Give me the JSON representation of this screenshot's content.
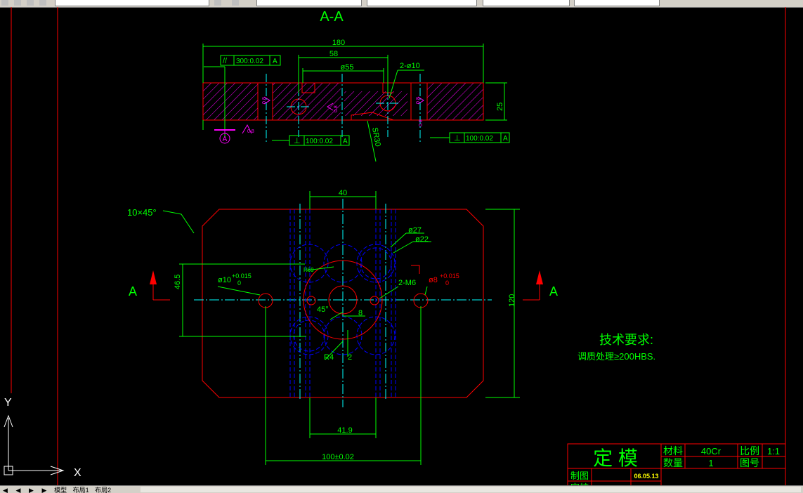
{
  "toolbar": {
    "fields": [
      "",
      "",
      "",
      "",
      ""
    ]
  },
  "drawing": {
    "section_title": "A-A",
    "top_view": {
      "dim_width": "180",
      "dim_58": "58",
      "dim_d55": "ø55",
      "dim_holes": "2-ø10",
      "dim_height": "25",
      "tol_parallel": [
        "//",
        "300:0.02",
        "A"
      ],
      "tol_perp_left": [
        "⊥",
        "100:0.02",
        "A"
      ],
      "tol_perp_right": [
        "⊥",
        "100:0.02",
        "A"
      ],
      "datum": "A",
      "sr_label": "SR30",
      "rough_1": "0.8",
      "rough_2": "0.8",
      "rough_3": "0.8",
      "rough_4": "0.8",
      "rough_5": "0.8"
    },
    "plan_view": {
      "chamfer": "10×45°",
      "dim_40": "40",
      "dim_d27": "ø27",
      "dim_d22": "ø22",
      "dim_46_5": "46.5",
      "dim_120": "120",
      "left_hole": "ø10",
      "left_hole_tol_up": "+0.015",
      "left_hole_tol_low": "0",
      "right_hole": "ø8",
      "right_hole_tol_up": "+0.015",
      "right_hole_tol_low": "0",
      "r_label": "R69",
      "thread": "2-M6",
      "angle": "45°",
      "dim_8": "8",
      "r4": "R4",
      "dim_2": "2",
      "dim_41_9": "41.9",
      "dim_100": "100±0.02",
      "section_left": "A",
      "section_right": "A"
    },
    "tech_req_title": "技术要求:",
    "tech_req_body": "调质处理≥200HBS.",
    "ucs": {
      "x": "X",
      "y": "Y"
    }
  },
  "title_block": {
    "part_name": "定 模",
    "material_label": "材料",
    "material_value": "40Cr",
    "scale_label": "比例",
    "scale_value": "1:1",
    "qty_label": "数量",
    "qty_value": "1",
    "drawing_no_label": "图号",
    "drawn_label": "制图",
    "date": "06.05.13",
    "check_label": "审核"
  },
  "tabs": [
    "模型",
    "布局1",
    "布局2"
  ],
  "colors": {
    "background": "#000000",
    "dimension": "#00ff00",
    "outline": "#ff0000",
    "hidden": "#0000ff",
    "center": "#00ffff",
    "roughness": "#ff00ff",
    "border": "#ff0000",
    "text_white": "#ffffff"
  }
}
